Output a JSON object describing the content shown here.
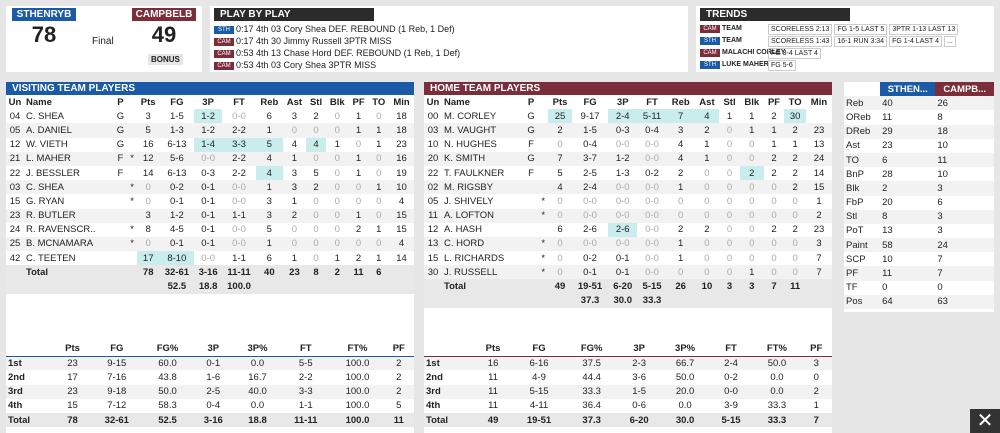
{
  "score": {
    "away_abbr": "STHENRYB",
    "away_score": "78",
    "home_abbr": "CAMPBELB",
    "home_score": "49",
    "status": "Final",
    "bonus": "BONUS"
  },
  "pbp": {
    "title": "PLAY BY PLAY",
    "rows": [
      {
        "team": "STH",
        "text": "0:17 4th 03 Cory Shea DEF. REBOUND (1 Reb, 1 Def)"
      },
      {
        "team": "CAM",
        "text": "0:17 4th 30 Jimmy Russell 3PTR MISS"
      },
      {
        "team": "CAM",
        "text": "0:53 4th 13 Chase Hord DEF. REBOUND (1 Reb, 1 Def)"
      },
      {
        "team": "CAM",
        "text": "0:53 4th 03 Cory Shea 3PTR MISS"
      },
      {
        "team": "STH",
        "text": "1:19 4th 15 Gabe Ryan DEF. REBOUND (3 Reb, 2 Def)"
      }
    ]
  },
  "trends": {
    "title": "TRENDS",
    "rows": [
      {
        "team": "CAM",
        "name": "TEAM",
        "chips": [
          "SCORELESS 2:13",
          "FG 1-5 LAST 5",
          "3PTR 1-13 LAST 13"
        ]
      },
      {
        "team": "STH",
        "name": "TEAM",
        "chips": [
          "SCORELESS 1:43",
          "16-1 RUN 3:34",
          "FG 1-4 LAST 4",
          "..."
        ]
      },
      {
        "team": "CAM",
        "name": "MALACHI CORLEY",
        "chips": [
          "FG 3-4 LAST 4"
        ]
      },
      {
        "team": "STH",
        "name": "LUKE MAHER",
        "chips": [
          "FG 5-6"
        ]
      }
    ]
  },
  "visiting": {
    "title": "VISITING TEAM PLAYERS",
    "columns": [
      "Un",
      "Name",
      "P",
      "",
      "Pts",
      "FG",
      "3P",
      "FT",
      "Reb",
      "Ast",
      "Stl",
      "Blk",
      "PF",
      "TO",
      "Min"
    ],
    "rows": [
      [
        "04",
        "C. SHEA",
        "G",
        "",
        "3",
        "1-5",
        "1-2",
        "0-0",
        "6",
        "3",
        "2",
        "0",
        "1",
        "0",
        "18"
      ],
      [
        "05",
        "A. DANIEL",
        "G",
        "",
        "5",
        "1-3",
        "1-2",
        "2-2",
        "1",
        "0",
        "0",
        "0",
        "1",
        "1",
        "18"
      ],
      [
        "12",
        "W. VIETH",
        "G",
        "",
        "16",
        "6-13",
        "1-4",
        "3-3",
        "5",
        "4",
        "4",
        "1",
        "0",
        "1",
        "23"
      ],
      [
        "21",
        "L. MAHER",
        "F",
        "*",
        "12",
        "5-6",
        "0-0",
        "2-2",
        "4",
        "1",
        "0",
        "0",
        "1",
        "0",
        "16"
      ],
      [
        "22",
        "J. BESSLER",
        "F",
        "",
        "14",
        "6-13",
        "0-3",
        "2-2",
        "4",
        "3",
        "5",
        "0",
        "1",
        "0",
        "19"
      ],
      [
        "03",
        "C. SHEA",
        "",
        "*",
        "0",
        "0-2",
        "0-1",
        "0-0",
        "1",
        "3",
        "2",
        "0",
        "0",
        "1",
        "10"
      ],
      [
        "15",
        "G. RYAN",
        "",
        "*",
        "0",
        "0-1",
        "0-1",
        "0-0",
        "3",
        "1",
        "0",
        "0",
        "0",
        "0",
        "4"
      ],
      [
        "23",
        "R. BUTLER",
        "",
        "",
        "3",
        "1-2",
        "0-1",
        "1-1",
        "3",
        "2",
        "0",
        "0",
        "1",
        "0",
        "15"
      ],
      [
        "24",
        "R. RAVENSCR..",
        "",
        "*",
        "8",
        "4-5",
        "0-1",
        "0-0",
        "5",
        "0",
        "0",
        "0",
        "2",
        "1",
        "15"
      ],
      [
        "25",
        "B. MCNAMARA",
        "",
        "*",
        "0",
        "0-1",
        "0-1",
        "0-0",
        "1",
        "0",
        "0",
        "0",
        "0",
        "0",
        "4"
      ],
      [
        "42",
        "C. TEETEN",
        "",
        "",
        "17",
        "8-10",
        "0-0",
        "1-1",
        "6",
        "1",
        "0",
        "1",
        "2",
        "1",
        "14"
      ]
    ],
    "total": [
      "",
      "Total",
      "",
      "",
      "78",
      "32-61",
      "3-16",
      "11-11",
      "40",
      "23",
      "8",
      "2",
      "11",
      "6",
      ""
    ],
    "pct": [
      "52.5",
      "18.8",
      "100.0"
    ],
    "periods_cols": [
      "",
      "Pts",
      "FG",
      "FG%",
      "3P",
      "3P%",
      "FT",
      "FT%",
      "PF"
    ],
    "periods": [
      [
        "1st",
        "23",
        "9-15",
        "60.0",
        "0-1",
        "0.0",
        "5-5",
        "100.0",
        "2"
      ],
      [
        "2nd",
        "17",
        "7-16",
        "43.8",
        "1-6",
        "16.7",
        "2-2",
        "100.0",
        "2"
      ],
      [
        "3rd",
        "23",
        "9-18",
        "50.0",
        "2-5",
        "40.0",
        "3-3",
        "100.0",
        "2"
      ],
      [
        "4th",
        "15",
        "7-12",
        "58.3",
        "0-4",
        "0.0",
        "1-1",
        "100.0",
        "5"
      ]
    ],
    "periods_total": [
      "Total",
      "78",
      "32-61",
      "52.5",
      "3-16",
      "18.8",
      "11-11",
      "100.0",
      "11"
    ]
  },
  "home": {
    "title": "HOME TEAM PLAYERS",
    "columns": [
      "Un",
      "Name",
      "P",
      "",
      "Pts",
      "FG",
      "3P",
      "FT",
      "Reb",
      "Ast",
      "Stl",
      "Blk",
      "PF",
      "TO",
      "Min"
    ],
    "rows": [
      [
        "00",
        "M. CORLEY",
        "G",
        "",
        "25",
        "9-17",
        "2-4",
        "5-11",
        "7",
        "4",
        "1",
        "1",
        "2",
        "30",
        ""
      ],
      [
        "03",
        "M. VAUGHT",
        "G",
        "",
        "2",
        "1-5",
        "0-3",
        "0-4",
        "3",
        "2",
        "0",
        "1",
        "1",
        "2",
        "23"
      ],
      [
        "10",
        "N. HUGHES",
        "F",
        "",
        "0",
        "0-4",
        "0-0",
        "0-0",
        "4",
        "1",
        "0",
        "0",
        "1",
        "1",
        "13"
      ],
      [
        "20",
        "K. SMITH",
        "G",
        "",
        "7",
        "3-7",
        "1-2",
        "0-0",
        "4",
        "1",
        "0",
        "0",
        "2",
        "2",
        "24"
      ],
      [
        "22",
        "T. FAULKNER",
        "F",
        "",
        "5",
        "2-5",
        "1-3",
        "0-2",
        "2",
        "0",
        "0",
        "2",
        "2",
        "2",
        "14"
      ],
      [
        "02",
        "M. RIGSBY",
        "",
        "",
        "4",
        "2-4",
        "0-0",
        "0-0",
        "1",
        "0",
        "0",
        "0",
        "0",
        "2",
        "15"
      ],
      [
        "05",
        "J. SHIVELY",
        "",
        "*",
        "0",
        "0-0",
        "0-0",
        "0-0",
        "0",
        "0",
        "0",
        "0",
        "0",
        "0",
        "1"
      ],
      [
        "11",
        "A. LOFTON",
        "",
        "*",
        "0",
        "0-0",
        "0-0",
        "0-0",
        "0",
        "0",
        "0",
        "0",
        "0",
        "0",
        "2"
      ],
      [
        "12",
        "A. HASH",
        "",
        "",
        "6",
        "2-6",
        "2-6",
        "0-0",
        "2",
        "2",
        "0",
        "0",
        "2",
        "2",
        "23"
      ],
      [
        "13",
        "C. HORD",
        "",
        "*",
        "0",
        "0-0",
        "0-0",
        "0-0",
        "1",
        "0",
        "0",
        "0",
        "0",
        "0",
        "3"
      ],
      [
        "15",
        "L. RICHARDS",
        "",
        "*",
        "0",
        "0-2",
        "0-1",
        "0-0",
        "1",
        "0",
        "0",
        "0",
        "0",
        "0",
        "7"
      ],
      [
        "30",
        "J. RUSSELL",
        "",
        "*",
        "0",
        "0-1",
        "0-1",
        "0-0",
        "0",
        "0",
        "0",
        "1",
        "0",
        "0",
        "7"
      ]
    ],
    "total": [
      "",
      "Total",
      "",
      "",
      "49",
      "19-51",
      "6-20",
      "5-15",
      "26",
      "10",
      "3",
      "3",
      "7",
      "11",
      ""
    ],
    "pct": [
      "37.3",
      "30.0",
      "33.3"
    ],
    "periods_cols": [
      "",
      "Pts",
      "FG",
      "FG%",
      "3P",
      "3P%",
      "FT",
      "FT%",
      "PF"
    ],
    "periods": [
      [
        "1st",
        "16",
        "6-16",
        "37.5",
        "2-3",
        "66.7",
        "2-4",
        "50.0",
        "3"
      ],
      [
        "2nd",
        "11",
        "4-9",
        "44.4",
        "3-6",
        "50.0",
        "0-2",
        "0.0",
        "0"
      ],
      [
        "3rd",
        "11",
        "5-15",
        "33.3",
        "1-5",
        "20.0",
        "0-0",
        "0.0",
        "2"
      ],
      [
        "4th",
        "11",
        "4-11",
        "36.4",
        "0-6",
        "0.0",
        "3-9",
        "33.3",
        "1"
      ]
    ],
    "periods_total": [
      "Total",
      "49",
      "19-51",
      "37.3",
      "6-20",
      "30.0",
      "5-15",
      "33.3",
      "7"
    ]
  },
  "team_stats": {
    "away": "STHEN...",
    "home": "CAMPB...",
    "rows": [
      [
        "Reb",
        "40",
        "26"
      ],
      [
        "OReb",
        "11",
        "8"
      ],
      [
        "DReb",
        "29",
        "18"
      ],
      [
        "Ast",
        "23",
        "10"
      ],
      [
        "TO",
        "6",
        "11"
      ],
      [
        "BnP",
        "28",
        "10"
      ],
      [
        "Blk",
        "2",
        "3"
      ],
      [
        "FbP",
        "20",
        "6"
      ],
      [
        "Stl",
        "8",
        "3"
      ],
      [
        "PoT",
        "13",
        "3"
      ],
      [
        "Paint",
        "58",
        "24"
      ],
      [
        "SCP",
        "10",
        "7"
      ],
      [
        "PF",
        "11",
        "7"
      ],
      [
        "TF",
        "0",
        "0"
      ],
      [
        "Pos",
        "64",
        "63"
      ]
    ]
  },
  "close_label": "✕",
  "colors": {
    "visiting": "#1b5aa6",
    "home": "#7b2d3a",
    "highlight": "#c9ecec"
  }
}
